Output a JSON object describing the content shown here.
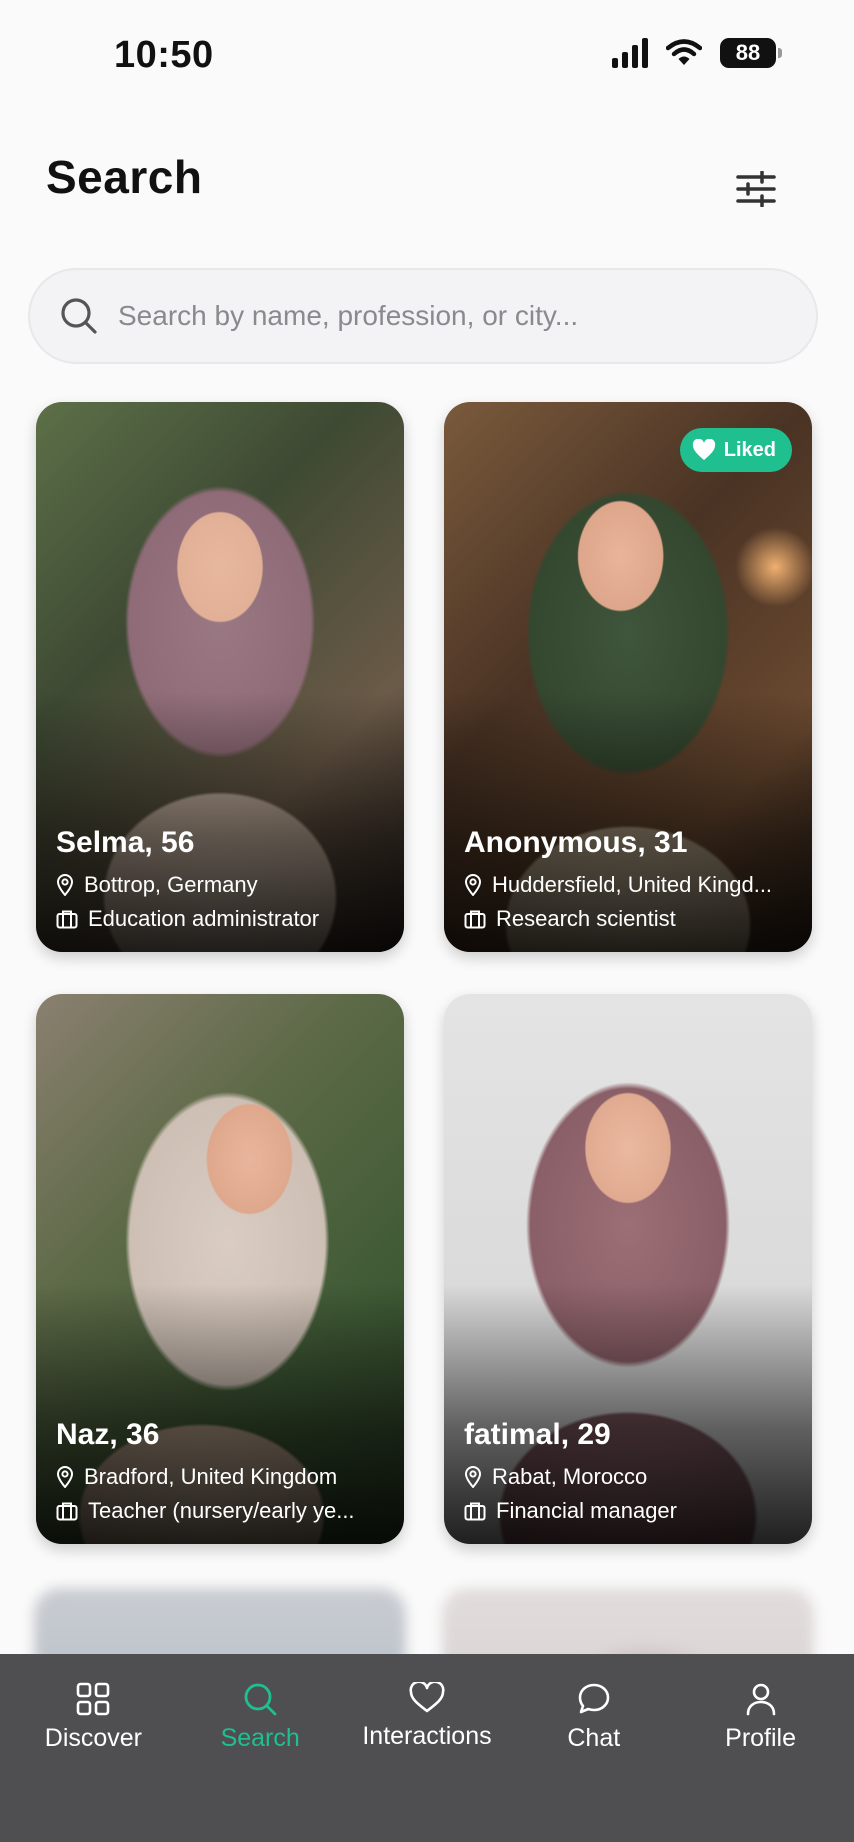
{
  "status_bar": {
    "time": "10:50",
    "battery": "88"
  },
  "header": {
    "title": "Search"
  },
  "search": {
    "placeholder": "Search by name, profession, or city..."
  },
  "colors": {
    "accent": "#1fbf8f",
    "nav_bg": "#4f4f51"
  },
  "profiles": [
    {
      "name": "Selma, 56",
      "location": "Bottrop, Germany",
      "job": "Education administrator",
      "liked": false
    },
    {
      "name": "Anonymous, 31",
      "location": "Huddersfield, United Kingd...",
      "job": "Research scientist",
      "liked": true,
      "badge": "Liked"
    },
    {
      "name": "Naz, 36",
      "location": "Bradford, United Kingdom",
      "job": "Teacher (nursery/early ye...",
      "liked": false
    },
    {
      "name": "fatimal, 29",
      "location": "Rabat, Morocco",
      "job": "Financial manager",
      "liked": false
    }
  ],
  "nav": [
    {
      "label": "Discover",
      "icon": "grid-icon",
      "active": false
    },
    {
      "label": "Search",
      "icon": "search-icon",
      "active": true
    },
    {
      "label": "Interactions",
      "icon": "heart-icon",
      "active": false
    },
    {
      "label": "Chat",
      "icon": "chat-bubble-icon",
      "active": false
    },
    {
      "label": "Profile",
      "icon": "person-icon",
      "active": false
    }
  ]
}
